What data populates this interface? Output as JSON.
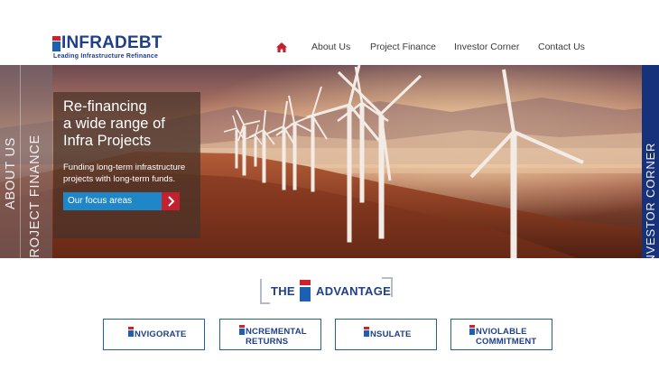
{
  "brand": {
    "name": "INFRADEBT",
    "tagline": "Leading Infrastructure Refinance",
    "colors": {
      "primary": "#1e3f8a",
      "accent": "#d0222b",
      "button": "#1f86c8"
    }
  },
  "nav": {
    "home_icon": "home-icon",
    "items": [
      {
        "label": "About Us"
      },
      {
        "label": "Project Finance"
      },
      {
        "label": "Investor Corner"
      },
      {
        "label": "Contact Us"
      }
    ]
  },
  "hero": {
    "side_left": {
      "outer": "ABOUT US",
      "inner": "PROJECT FINANCE"
    },
    "side_right": "INVESTOR CORNER",
    "promo": {
      "title_lines": [
        "Re-financing",
        "a wide range of",
        "Infra Projects"
      ],
      "desc_lines": [
        "Funding long-term infrastructure",
        "projects with long-term funds."
      ],
      "button_label": "Our focus areas",
      "button_icon": "chevron-right-icon"
    }
  },
  "advantage": {
    "prefix": "THE",
    "suffix": "ADVANTAGE",
    "pillars": [
      {
        "line1": "NVIGORATE",
        "line2": ""
      },
      {
        "line1": "NCREMENTAL",
        "line2": "RETURNS"
      },
      {
        "line1": "NSULATE",
        "line2": ""
      },
      {
        "line1": "NVIOLABLE",
        "line2": "COMMITMENT"
      }
    ]
  }
}
